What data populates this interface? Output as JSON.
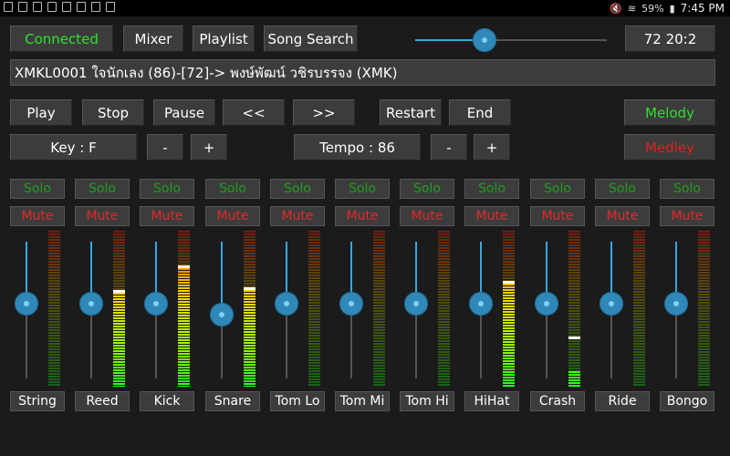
{
  "status_bar": {
    "time": "7:45 PM",
    "battery": "59%"
  },
  "top": {
    "connected_label": "Connected",
    "mixer_label": "Mixer",
    "playlist_label": "Playlist",
    "song_search_label": "Song Search",
    "volume_level": 0.36,
    "counter_text": "72  20:2"
  },
  "song": {
    "title": "XMKL0001 ใจนักเลง (86)-[72]-> พงษ์พัฒน์ วชิรบรรจง (XMK)"
  },
  "transport": {
    "play": "Play",
    "stop": "Stop",
    "pause": "Pause",
    "rewind": "<<",
    "forward": ">>",
    "restart": "Restart",
    "end": "End",
    "melody": "Melody",
    "medley": "Medley"
  },
  "key": {
    "label": "Key : F",
    "minus": "-",
    "plus": "+"
  },
  "tempo": {
    "label": "Tempo : 86",
    "minus": "-",
    "plus": "+"
  },
  "channel_labels": {
    "solo": "Solo",
    "mute": "Mute"
  },
  "channels": [
    {
      "name": "String",
      "fader": 0.55,
      "meter": 0.0,
      "peak": null
    },
    {
      "name": "Reed",
      "fader": 0.55,
      "meter": 0.62,
      "peak": 0.62
    },
    {
      "name": "Kick",
      "fader": 0.55,
      "meter": 0.78,
      "peak": 0.78
    },
    {
      "name": "Snare",
      "fader": 0.47,
      "meter": 0.64,
      "peak": 0.64
    },
    {
      "name": "Tom Lo",
      "fader": 0.55,
      "meter": 0.0,
      "peak": null
    },
    {
      "name": "Tom Mi",
      "fader": 0.55,
      "meter": 0.0,
      "peak": null
    },
    {
      "name": "Tom Hi",
      "fader": 0.55,
      "meter": 0.0,
      "peak": null
    },
    {
      "name": "HiHat",
      "fader": 0.55,
      "meter": 0.68,
      "peak": 0.68
    },
    {
      "name": "Crash",
      "fader": 0.55,
      "meter": 0.1,
      "peak": 0.32
    },
    {
      "name": "Ride",
      "fader": 0.55,
      "meter": 0.0,
      "peak": null
    },
    {
      "name": "Bongo",
      "fader": 0.55,
      "meter": 0.0,
      "peak": null
    }
  ],
  "colors": {
    "accent": "#35a8e0",
    "connected": "#2fe02f",
    "medley": "#e02020"
  }
}
